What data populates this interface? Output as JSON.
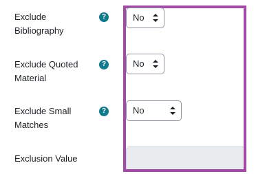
{
  "form": {
    "fields": [
      {
        "label": "Exclude Bibliography",
        "value": "No",
        "help": "?"
      },
      {
        "label": "Exclude Quoted Material",
        "value": "No",
        "help": "?"
      },
      {
        "label": "Exclude Small Matches",
        "value": "No",
        "help": "?"
      },
      {
        "label": "Exclusion Value",
        "value": ""
      }
    ]
  },
  "colors": {
    "highlight_border": "#a14aa6",
    "help_icon": "#117a8b",
    "disabled_input_bg": "#e9ecef"
  },
  "icons": [
    "help-circle-icon",
    "select-caret-icon"
  ]
}
